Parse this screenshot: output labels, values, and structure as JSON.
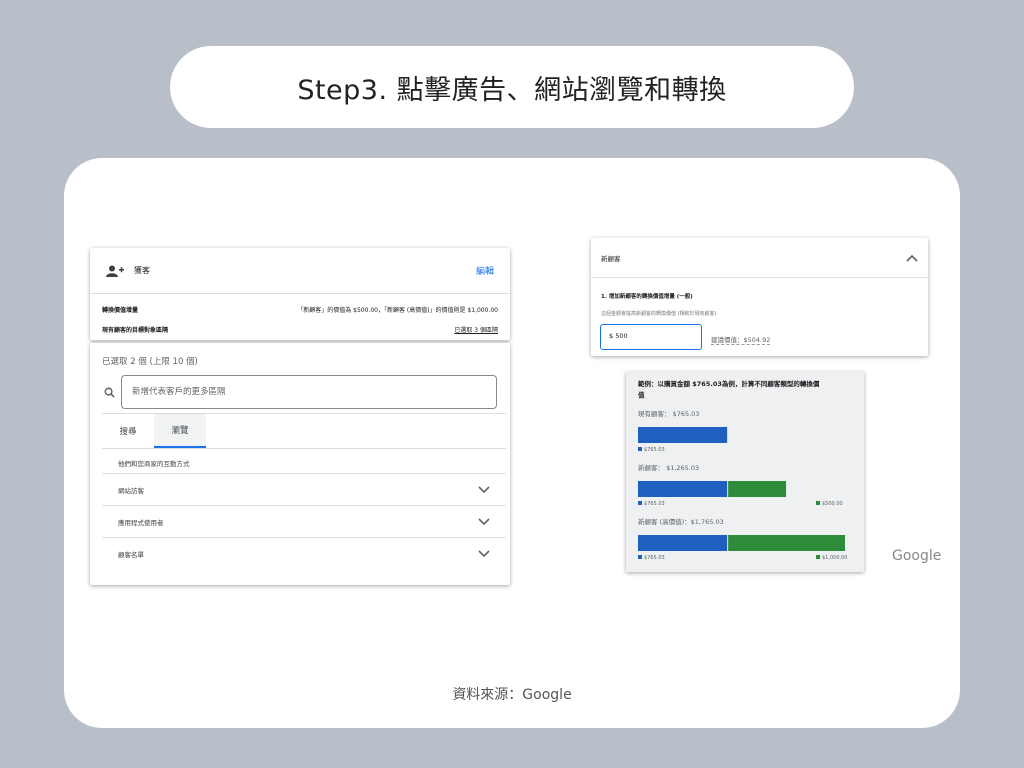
{
  "title": "Step3. 點擊廣告、網站瀏覽和轉換",
  "source": "資料來源：Google",
  "google_logo": "Google",
  "left_panel": {
    "header": "獲客",
    "edit": "編輯",
    "rows": [
      {
        "label": "轉換價值增量",
        "value": "「新顧客」的價值為 $500.00，「新顧客 (高價值)」的價值則是 $1,000.00"
      },
      {
        "label": "現有顧客的目標對象區隔",
        "value": "已選取 3 個區隔"
      }
    ],
    "selected_count": "已選取 2 個 (上限 10 個)",
    "search_placeholder": "新增代表客戶的更多區隔",
    "tabs": [
      "搜尋",
      "瀏覽"
    ],
    "hint": "他們和您商家的互動方式",
    "items": [
      "網站訪客",
      "應用程式使用者",
      "顧客名單"
    ]
  },
  "right_panel": {
    "header": "新顧客",
    "line1": "1. 增加新顧客的轉換價值增量 (一般)",
    "line2": "這個金額會提高新顧客的轉換價值 (相較於現有顧客)",
    "input_value": "$ 500",
    "suggest": "建議價值：$504.92"
  },
  "chart_data": {
    "type": "bar",
    "title": "範例：以購買金額 $765.03為例，計算不同顧客類型的轉換價值",
    "groups": [
      {
        "label": "現有顧客： $765.03",
        "segments": [
          {
            "value": 765.03,
            "label": "$765.03",
            "color": "#1f5fbf"
          }
        ]
      },
      {
        "label": "新顧客： $1,265.03",
        "segments": [
          {
            "value": 765.03,
            "label": "$765.03",
            "color": "#1f5fbf"
          },
          {
            "value": 500,
            "label": "$500.00",
            "color": "#2e8b3a"
          }
        ]
      },
      {
        "label": "新顧客 (高價值)：$1,765.03",
        "segments": [
          {
            "value": 765.03,
            "label": "$765.03",
            "color": "#1f5fbf"
          },
          {
            "value": 1000,
            "label": "$1,000.00",
            "color": "#2e8b3a"
          }
        ]
      }
    ]
  }
}
